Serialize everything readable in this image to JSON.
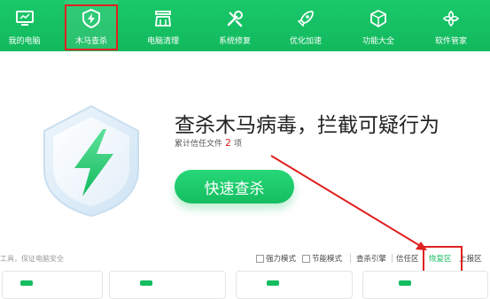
{
  "nav": {
    "items": [
      {
        "label": "我的电脑",
        "icon": "monitor-icon"
      },
      {
        "label": "木马查杀",
        "icon": "shield-lightning-icon"
      },
      {
        "label": "电脑清理",
        "icon": "broom-icon"
      },
      {
        "label": "系统修复",
        "icon": "tools-icon"
      },
      {
        "label": "优化加速",
        "icon": "rocket-icon"
      },
      {
        "label": "功能大全",
        "icon": "cube-icon"
      },
      {
        "label": "软件管家",
        "icon": "grid-flower-icon"
      }
    ],
    "active": "木马查杀"
  },
  "hero": {
    "title": "查杀木马病毒，拦截可疑行为",
    "trust_prefix": "累计信任文件",
    "trust_count": "2",
    "trust_suffix": "项",
    "scan_button": "快速查杀"
  },
  "footer": {
    "left_text": "工具，保证电脑安全",
    "strong_mode": "强力模式",
    "power_mode": "节能模式",
    "engine": "查杀引擎",
    "trust_zone": "信任区",
    "restore_zone": "恢复区",
    "report_zone": "上报区"
  },
  "colors": {
    "brand_green": "#14bd60",
    "annotation_red": "#e02020"
  }
}
